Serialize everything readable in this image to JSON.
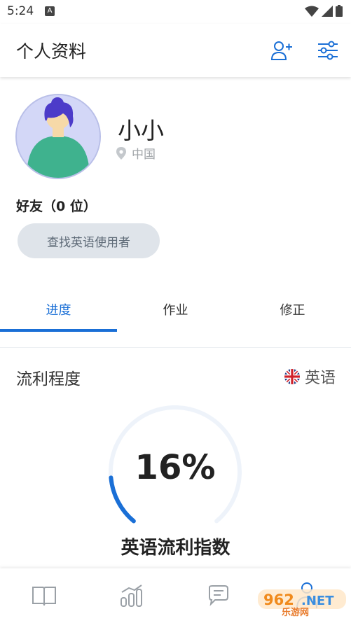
{
  "status_bar": {
    "time": "5:24",
    "notification_glyph": "A"
  },
  "header": {
    "title": "个人资料",
    "add_friend_icon": "add-person-icon",
    "settings_icon": "sliders-icon"
  },
  "profile": {
    "name": "小小",
    "location": "中国"
  },
  "friends": {
    "heading": "好友（0 位）",
    "find_button": "查找英语使用者"
  },
  "tabs": [
    {
      "label": "进度",
      "active": true
    },
    {
      "label": "作业",
      "active": false
    },
    {
      "label": "修正",
      "active": false
    }
  ],
  "fluency": {
    "title": "流利程度",
    "language": "英语",
    "flag_icon": "uk-flag-icon",
    "value_text": "16%",
    "value": 0.16,
    "caption": "英语流利指数"
  },
  "bottom_nav": [
    {
      "icon": "book-icon"
    },
    {
      "icon": "bar-chart-icon"
    },
    {
      "icon": "chat-icon"
    },
    {
      "icon": "profile-icon"
    }
  ],
  "watermark": {
    "logo": "962.NET",
    "text": "乐游网"
  },
  "colors": {
    "accent": "#1a6fd6",
    "track": "#eef3fa",
    "button_bg": "#dfe4ea"
  }
}
